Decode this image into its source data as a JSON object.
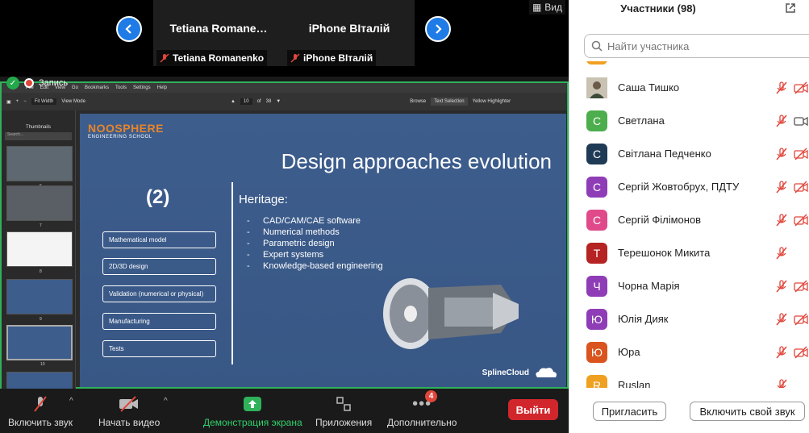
{
  "meeting": {
    "tiles": [
      {
        "name": "Tetiana  Romane…",
        "label": "Tetiana Romanenko"
      },
      {
        "name": "iPhone ВІталій",
        "label": "iPhone ВІталій"
      }
    ],
    "view_label": "Вид",
    "record_label": "Запись"
  },
  "pdf": {
    "menu": [
      "File",
      "Edit",
      "View",
      "Go",
      "Bookmarks",
      "Tools",
      "Settings",
      "Help"
    ],
    "fit": "Fit Width",
    "viewmode": "View Mode",
    "page_current": "10",
    "page_of": "of",
    "page_total": "38",
    "browse": "Browse",
    "text_sel": "Text Selection",
    "yellow": "Yellow Highlighter",
    "thumbs_label": "Thumbnails",
    "search_ph": "Search...",
    "thumb_numbers": [
      "6",
      "7",
      "8",
      "9",
      "10"
    ]
  },
  "slide": {
    "logo_main": "NOOSPHERE",
    "logo_sub": "ENGINEERING SCHOOL",
    "title": "Design approaches evolution",
    "number": "(2)",
    "boxes": [
      "Mathematical model",
      "2D/3D design",
      "Validation (numerical or physical)",
      "Manufacturing",
      "Tests"
    ],
    "heritage_title": "Heritage:",
    "heritage": [
      "CAD/CAM/CAE software",
      "Numerical methods",
      "Parametric design",
      "Expert systems",
      "Knowledge-based engineering"
    ],
    "brand": "SplineCloud"
  },
  "toolbar": {
    "audio": "Включить звук",
    "video": "Начать видео",
    "share": "Демонстрация экрана",
    "apps": "Приложения",
    "more": "Дополнительно",
    "more_badge": "4",
    "leave": "Выйти"
  },
  "panel": {
    "title": "Участники (98)",
    "search_placeholder": "Найти участника",
    "participants": [
      {
        "name": "Саша Тишко",
        "initial": "",
        "color": "#8a9a7a",
        "mic": "muted",
        "cam": "off"
      },
      {
        "name": "Светлана",
        "initial": "С",
        "color": "#4cae4c",
        "mic": "muted",
        "cam": "on"
      },
      {
        "name": "Світлана Педченко",
        "initial": "С",
        "color": "#1f3a55",
        "mic": "muted",
        "cam": "off"
      },
      {
        "name": "Сергій Жовтобрух, ПДТУ",
        "initial": "С",
        "color": "#8e3db7",
        "mic": "muted",
        "cam": "off"
      },
      {
        "name": "Сергій Філімонов",
        "initial": "С",
        "color": "#e04a8a",
        "mic": "muted",
        "cam": "off"
      },
      {
        "name": "Терешонок Микита",
        "initial": "Т",
        "color": "#b52323",
        "mic": "muted",
        "cam": "none"
      },
      {
        "name": "Чорна Марія",
        "initial": "Ч",
        "color": "#8e3db7",
        "mic": "muted",
        "cam": "off"
      },
      {
        "name": "Юлія Дияк",
        "initial": "Ю",
        "color": "#8e3db7",
        "mic": "muted",
        "cam": "off"
      },
      {
        "name": "Юра",
        "initial": "Ю",
        "color": "#d9541e",
        "mic": "muted",
        "cam": "off"
      },
      {
        "name": "Ruslan",
        "initial": "R",
        "color": "#f0a020",
        "mic": "muted",
        "cam": "none"
      }
    ],
    "invite": "Пригласить",
    "unmute": "Включить свой звук"
  }
}
